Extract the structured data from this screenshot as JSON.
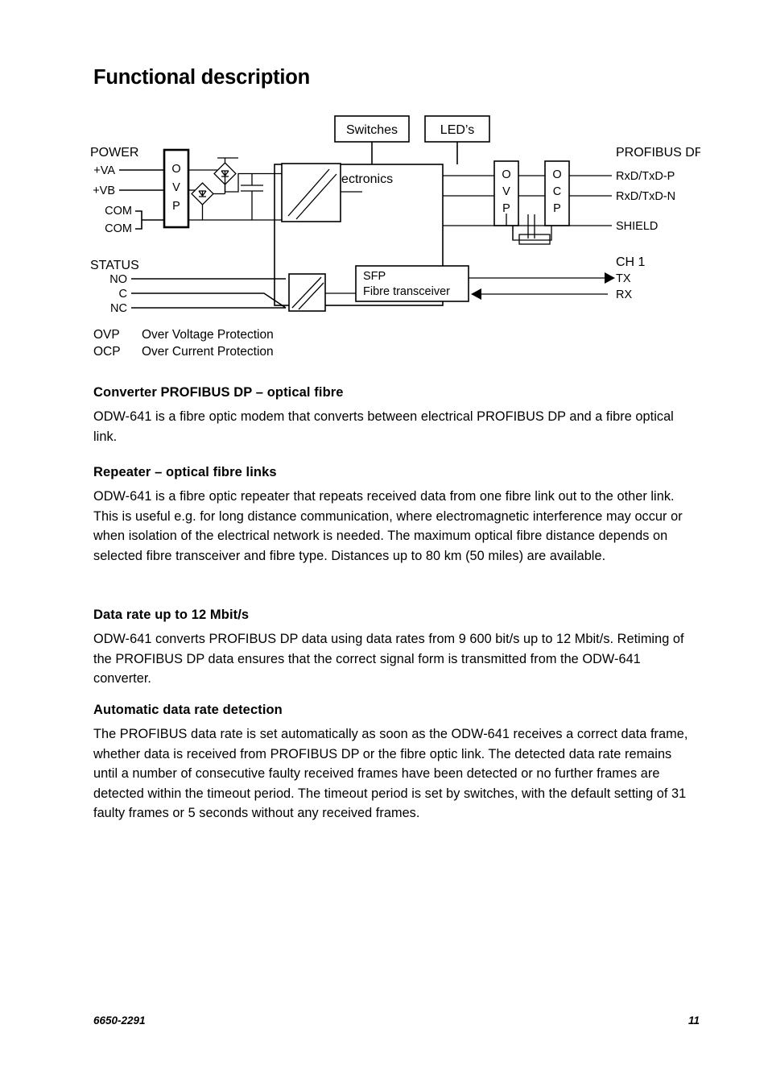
{
  "page": {
    "title": "Functional description"
  },
  "diagram": {
    "name": "odw-641-block-diagram",
    "labels": {
      "power_group": "POWER",
      "power_terminals": [
        "+VA",
        "+VB",
        "COM",
        "COM"
      ],
      "status_group": "STATUS",
      "status_terminals": [
        "NO",
        "C",
        "NC"
      ],
      "switches_box": "Switches",
      "leds_box": "LED’s",
      "internal_electronics_box": "Internal Electronics",
      "ovp_power_box": [
        "O",
        "V",
        "P"
      ],
      "ovp_bus_box": [
        "O",
        "V",
        "P"
      ],
      "ocp_box": [
        "O",
        "C",
        "P"
      ],
      "sfp_box_line1": "SFP",
      "sfp_box_line2": "Fibre transceiver",
      "profibus_group": "PROFIBUS DP",
      "profibus_terminals": [
        "RxD/TxD-P",
        "RxD/TxD-N",
        "SHIELD"
      ],
      "channel_group": "CH 1",
      "channel_terminals": [
        "TX",
        "RX"
      ]
    }
  },
  "legend": [
    {
      "abbr": "OVP",
      "meaning": "Over Voltage Protection"
    },
    {
      "abbr": "OCP",
      "meaning": "Over Current Protection"
    }
  ],
  "sections": [
    {
      "heading": "Converter PROFIBUS DP – optical fibre",
      "body": "ODW-641 is a fibre optic modem that converts between electrical PROFIBUS DP and a fibre optical link."
    },
    {
      "heading": "Repeater – optical fibre links",
      "body": "ODW-641 is a fibre optic repeater that repeats received data from one fibre link out to the other link. This is useful e.g. for long distance communication, where electromagnetic interference may occur or when isolation of the electrical network is needed. The maximum optical fibre distance depends on selected fibre transceiver and fibre type. Distances up to 80 km (50 miles) are available."
    },
    {
      "heading": "Data rate up to 12 Mbit/s",
      "body": "ODW-641 converts PROFIBUS DP data using data rates from 9 600 bit/s up to 12 Mbit/s. Retiming of the PROFIBUS DP data ensures that the correct signal form is transmitted from the ODW-641 converter."
    },
    {
      "heading": "Automatic data rate detection",
      "body": "The PROFIBUS data rate is set automatically as soon as the ODW-641 receives a correct data frame, whether data is received from PROFIBUS DP or the fibre optic link. The detected data rate remains until a number of consecutive faulty received frames have been detected or no further frames are detected within the timeout period. The timeout period is set by switches, with the default setting of 31 faulty frames or 5 seconds without any received frames."
    }
  ],
  "footer": {
    "document_number": "6650-2291",
    "page_number": "11"
  },
  "colors": {
    "text": "#000000",
    "background": "#ffffff",
    "rule": "#000000"
  }
}
